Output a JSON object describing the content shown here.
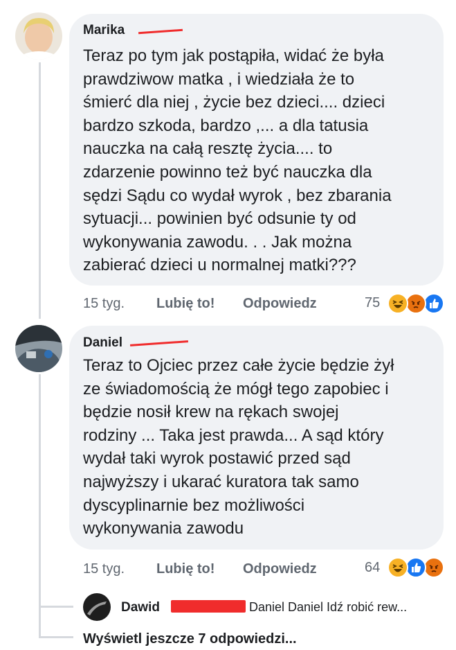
{
  "comments": [
    {
      "author": "Marika",
      "body_lines": [
        "Teraz po tym jak postąpiła,  widać że była",
        "prawdziwow matka , i wiedziała że to",
        "śmierć dla niej , życie bez dzieci.... dzieci",
        "bardzo szkoda, bardzo ,... a dla tatusia",
        "nauczka na całą resztę życia.... to",
        "zdarzenie powinno też być nauczka dla",
        "sędzi Sądu co wydał wyrok , bez zbarania",
        "sytuacji... powinien być odsunie ty od",
        "wykonywania zawodu. . . Jak można",
        "zabierać dzieci u normalnej matki???"
      ],
      "time": "15 tyg.",
      "like_label": "Lubię to!",
      "reply_label": "Odpowiedz",
      "reaction_count": "75",
      "reactions": [
        "haha-icon",
        "angry-icon",
        "like-icon"
      ]
    },
    {
      "author": "Daniel",
      "body_lines": [
        "Teraz to Ojciec przez całe życie będzie żył",
        "ze świadomością że mógł tego zapobiec i",
        "będzie nosił krew na rękach swojej",
        "rodziny ... Taka jest prawda... A sąd który",
        "wydał taki wyrok postawić przed sąd",
        "najwyższy i ukarać kuratora tak samo",
        "dyscyplinarnie bez możliwości",
        "wykonywania zawodu"
      ],
      "time": "15 tyg.",
      "like_label": "Lubię to!",
      "reply_label": "Odpowiedz",
      "reaction_count": "64",
      "reactions": [
        "haha-icon",
        "like-icon",
        "angry-icon"
      ]
    }
  ],
  "reply": {
    "author": "Dawid",
    "preview": "Daniel Daniel Idź robić rew..."
  },
  "more_replies_label": "Wyświetl jeszcze 7 odpowiedzi...",
  "colors": {
    "bubble": "#f0f2f5",
    "meta_text": "#606770",
    "redaction": "#f02c2c",
    "like_blue": "#1877f2",
    "angry_orange": "#e9710f",
    "haha_yellow": "#f7b125"
  }
}
